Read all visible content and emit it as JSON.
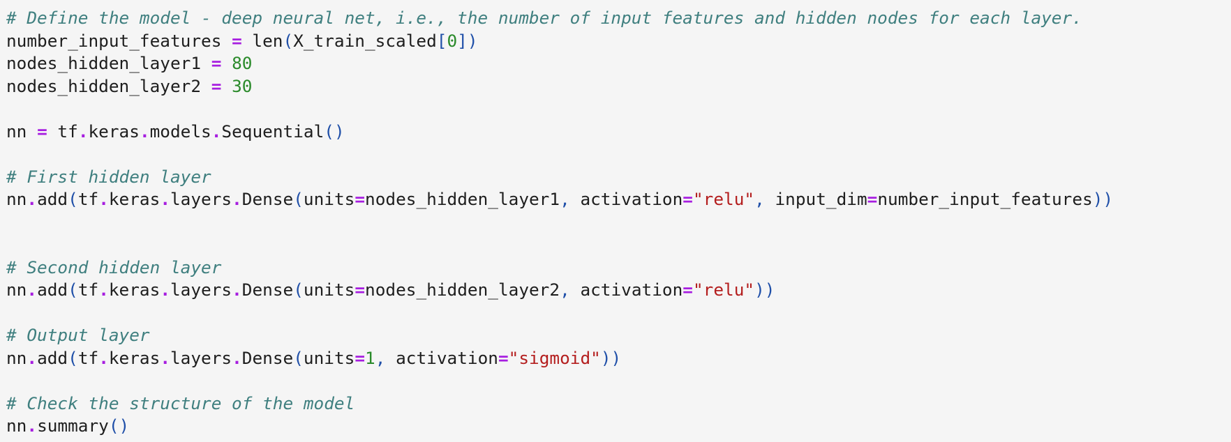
{
  "colors": {
    "background": "#f5f5f5",
    "text": "#1e1e1e",
    "comment": "#3f7f7f",
    "operator": "#a71ee0",
    "number": "#2a8a2a",
    "string": "#b41e1e",
    "paren": "#1f4fa8"
  },
  "code": {
    "lines": [
      [
        {
          "t": "# Define the model - deep neural net, i.e., the number of input features and hidden nodes for each layer.",
          "c": "comment"
        }
      ],
      [
        {
          "t": "number_input_features ",
          "c": "name"
        },
        {
          "t": "=",
          "c": "op"
        },
        {
          "t": " len",
          "c": "builtin"
        },
        {
          "t": "(",
          "c": "paren"
        },
        {
          "t": "X_train_scaled",
          "c": "name"
        },
        {
          "t": "[",
          "c": "paren"
        },
        {
          "t": "0",
          "c": "num"
        },
        {
          "t": "])",
          "c": "paren"
        }
      ],
      [
        {
          "t": "nodes_hidden_layer1 ",
          "c": "name"
        },
        {
          "t": "=",
          "c": "op"
        },
        {
          "t": " ",
          "c": "name"
        },
        {
          "t": "80",
          "c": "num"
        }
      ],
      [
        {
          "t": "nodes_hidden_layer2 ",
          "c": "name"
        },
        {
          "t": "=",
          "c": "op"
        },
        {
          "t": " ",
          "c": "name"
        },
        {
          "t": "30",
          "c": "num"
        }
      ],
      [],
      [
        {
          "t": "nn ",
          "c": "name"
        },
        {
          "t": "=",
          "c": "op"
        },
        {
          "t": " tf",
          "c": "name"
        },
        {
          "t": ".",
          "c": "op"
        },
        {
          "t": "keras",
          "c": "name"
        },
        {
          "t": ".",
          "c": "op"
        },
        {
          "t": "models",
          "c": "name"
        },
        {
          "t": ".",
          "c": "op"
        },
        {
          "t": "Sequential",
          "c": "name"
        },
        {
          "t": "()",
          "c": "paren"
        }
      ],
      [],
      [
        {
          "t": "# First hidden layer",
          "c": "comment"
        }
      ],
      [
        {
          "t": "nn",
          "c": "name"
        },
        {
          "t": ".",
          "c": "op"
        },
        {
          "t": "add",
          "c": "name"
        },
        {
          "t": "(",
          "c": "paren"
        },
        {
          "t": "tf",
          "c": "name"
        },
        {
          "t": ".",
          "c": "op"
        },
        {
          "t": "keras",
          "c": "name"
        },
        {
          "t": ".",
          "c": "op"
        },
        {
          "t": "layers",
          "c": "name"
        },
        {
          "t": ".",
          "c": "op"
        },
        {
          "t": "Dense",
          "c": "name"
        },
        {
          "t": "(",
          "c": "paren"
        },
        {
          "t": "units",
          "c": "name"
        },
        {
          "t": "=",
          "c": "op"
        },
        {
          "t": "nodes_hidden_layer1",
          "c": "name"
        },
        {
          "t": ", ",
          "c": "paren"
        },
        {
          "t": "activation",
          "c": "name"
        },
        {
          "t": "=",
          "c": "op"
        },
        {
          "t": "\"relu\"",
          "c": "str"
        },
        {
          "t": ", ",
          "c": "paren"
        },
        {
          "t": "input_dim",
          "c": "name"
        },
        {
          "t": "=",
          "c": "op"
        },
        {
          "t": "number_input_features",
          "c": "name"
        },
        {
          "t": "))",
          "c": "paren"
        }
      ],
      [],
      [],
      [
        {
          "t": "# Second hidden layer",
          "c": "comment"
        }
      ],
      [
        {
          "t": "nn",
          "c": "name"
        },
        {
          "t": ".",
          "c": "op"
        },
        {
          "t": "add",
          "c": "name"
        },
        {
          "t": "(",
          "c": "paren"
        },
        {
          "t": "tf",
          "c": "name"
        },
        {
          "t": ".",
          "c": "op"
        },
        {
          "t": "keras",
          "c": "name"
        },
        {
          "t": ".",
          "c": "op"
        },
        {
          "t": "layers",
          "c": "name"
        },
        {
          "t": ".",
          "c": "op"
        },
        {
          "t": "Dense",
          "c": "name"
        },
        {
          "t": "(",
          "c": "paren"
        },
        {
          "t": "units",
          "c": "name"
        },
        {
          "t": "=",
          "c": "op"
        },
        {
          "t": "nodes_hidden_layer2",
          "c": "name"
        },
        {
          "t": ", ",
          "c": "paren"
        },
        {
          "t": "activation",
          "c": "name"
        },
        {
          "t": "=",
          "c": "op"
        },
        {
          "t": "\"relu\"",
          "c": "str"
        },
        {
          "t": "))",
          "c": "paren"
        }
      ],
      [],
      [
        {
          "t": "# Output layer",
          "c": "comment"
        }
      ],
      [
        {
          "t": "nn",
          "c": "name"
        },
        {
          "t": ".",
          "c": "op"
        },
        {
          "t": "add",
          "c": "name"
        },
        {
          "t": "(",
          "c": "paren"
        },
        {
          "t": "tf",
          "c": "name"
        },
        {
          "t": ".",
          "c": "op"
        },
        {
          "t": "keras",
          "c": "name"
        },
        {
          "t": ".",
          "c": "op"
        },
        {
          "t": "layers",
          "c": "name"
        },
        {
          "t": ".",
          "c": "op"
        },
        {
          "t": "Dense",
          "c": "name"
        },
        {
          "t": "(",
          "c": "paren"
        },
        {
          "t": "units",
          "c": "name"
        },
        {
          "t": "=",
          "c": "op"
        },
        {
          "t": "1",
          "c": "num"
        },
        {
          "t": ", ",
          "c": "paren"
        },
        {
          "t": "activation",
          "c": "name"
        },
        {
          "t": "=",
          "c": "op"
        },
        {
          "t": "\"sigmoid\"",
          "c": "str"
        },
        {
          "t": "))",
          "c": "paren"
        }
      ],
      [],
      [
        {
          "t": "# Check the structure of the model",
          "c": "comment"
        }
      ],
      [
        {
          "t": "nn",
          "c": "name"
        },
        {
          "t": ".",
          "c": "op"
        },
        {
          "t": "summary",
          "c": "name"
        },
        {
          "t": "()",
          "c": "paren"
        }
      ]
    ]
  }
}
